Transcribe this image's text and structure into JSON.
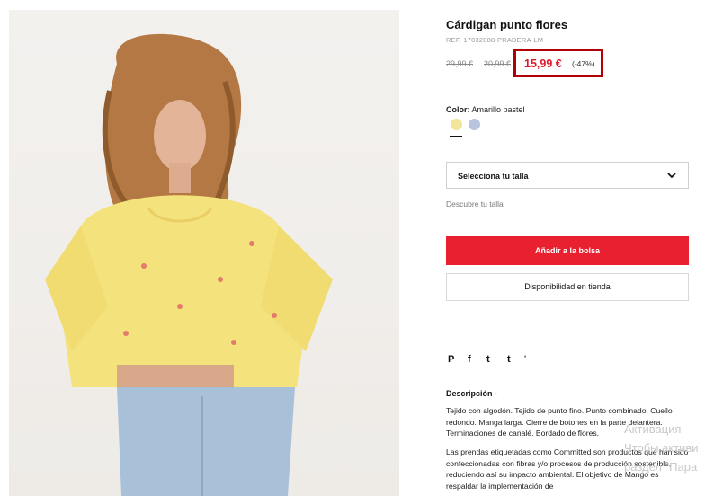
{
  "product": {
    "title": "Cárdigan punto flores",
    "ref": "REF. 17032888-PRADERA-LM",
    "old_price_1": "29,99 €",
    "old_price_2": "20,99 €",
    "price_now": "15,99 €",
    "discount": "(-47%)"
  },
  "color": {
    "label": "Color:",
    "value": "Amarillo pastel",
    "swatches": [
      "#f1e69a",
      "#b8c4de"
    ]
  },
  "size": {
    "select_label": "Selecciona tu talla",
    "guide_link": "Descubre tu talla"
  },
  "buttons": {
    "add_to_bag": "Añadir a la bolsa",
    "store_availability": "Disponibilidad en tienda"
  },
  "social": {
    "pinterest": "P",
    "facebook": "f",
    "twitter": "t",
    "tumblr": "t",
    "more": "'"
  },
  "description": {
    "title": "Descripción -",
    "p1": "Tejido con algodón. Tejido de punto fino. Punto combinado. Cuello redondo. Manga larga. Cierre de botones en la parte delantera. Terminaciones de canalé. Bordado de flores.",
    "p2": "Las prendas etiquetadas como Committed son productos que han sido confeccionadas con fibras y/o procesos de producción sostenible, reduciendo así su impacto ambiental. El objetivo de Mango es respaldar la implementación de"
  },
  "watermark": {
    "line1": "Активация",
    "line2": "Чтобы активи",
    "line3": "раздел \"Пара"
  },
  "colors": {
    "accent_red": "#e8202f",
    "price_red": "#e0182d",
    "highlight_box": "#b00006"
  }
}
